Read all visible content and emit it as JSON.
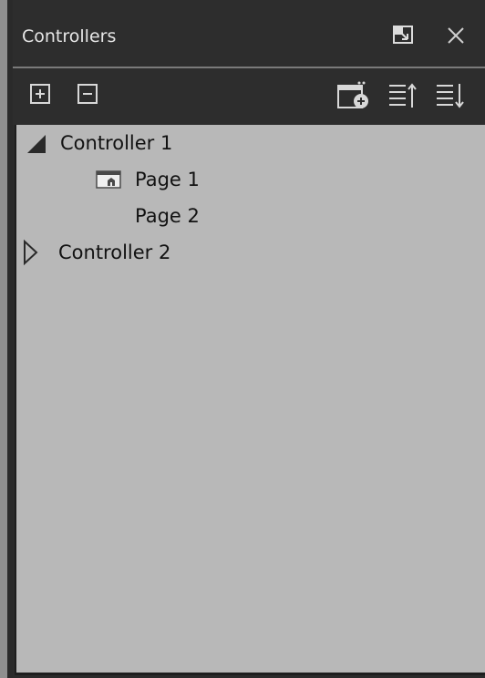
{
  "panel": {
    "title": "Controllers"
  },
  "header_icons": {
    "restore": "window-restore-icon",
    "close": "close-icon"
  },
  "toolbar": {
    "add": "plus-square-icon",
    "remove": "minus-square-icon",
    "add_page": "add-page-icon",
    "sort_up": "sort-ascending-icon",
    "sort_down": "sort-descending-icon"
  },
  "tree": {
    "controller1": {
      "label": "Controller 1",
      "expanded": true
    },
    "page1": {
      "label": "Page 1",
      "has_home_icon": true
    },
    "page2": {
      "label": "Page 2"
    },
    "controller2": {
      "label": "Controller 2",
      "expanded": false
    }
  },
  "colors": {
    "header_bg": "#2d2d2d",
    "tree_bg": "#b8b8b8",
    "text_light": "#e6e6e6",
    "text_dark": "#121212"
  }
}
